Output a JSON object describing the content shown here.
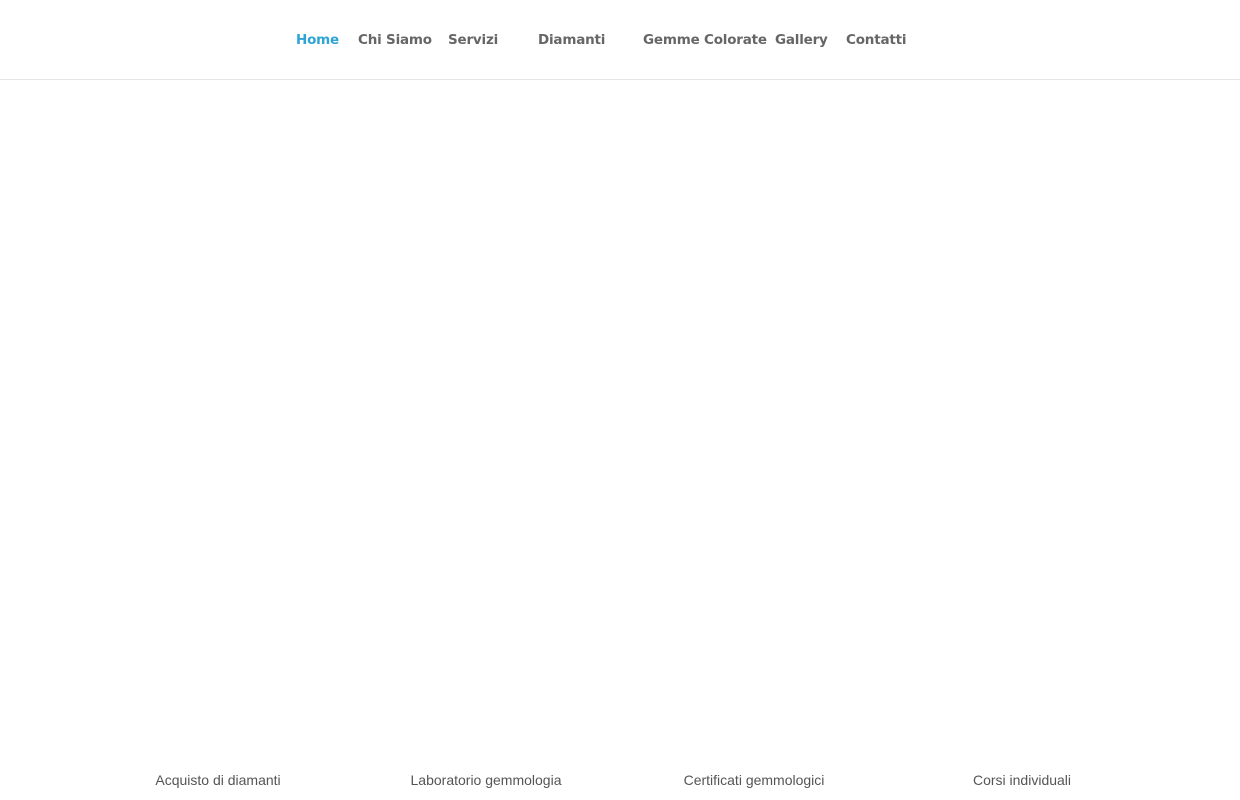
{
  "nav": {
    "items": [
      {
        "label": "Home",
        "active": true
      },
      {
        "label": "Chi Siamo",
        "active": false
      },
      {
        "label": "Servizi",
        "active": false
      },
      {
        "label": "Diamanti",
        "active": false
      },
      {
        "label": "Gemme Colorate",
        "active": false
      },
      {
        "label": "Gallery",
        "active": false
      },
      {
        "label": "Contatti",
        "active": false
      }
    ],
    "active_color": "#2ea3d6",
    "text_color": "#666666"
  },
  "services": {
    "items": [
      {
        "label": "Acquisto di diamanti"
      },
      {
        "label": "Laboratorio gemmologia"
      },
      {
        "label": "Certificati gemmologici"
      },
      {
        "label": "Corsi individuali"
      }
    ]
  }
}
